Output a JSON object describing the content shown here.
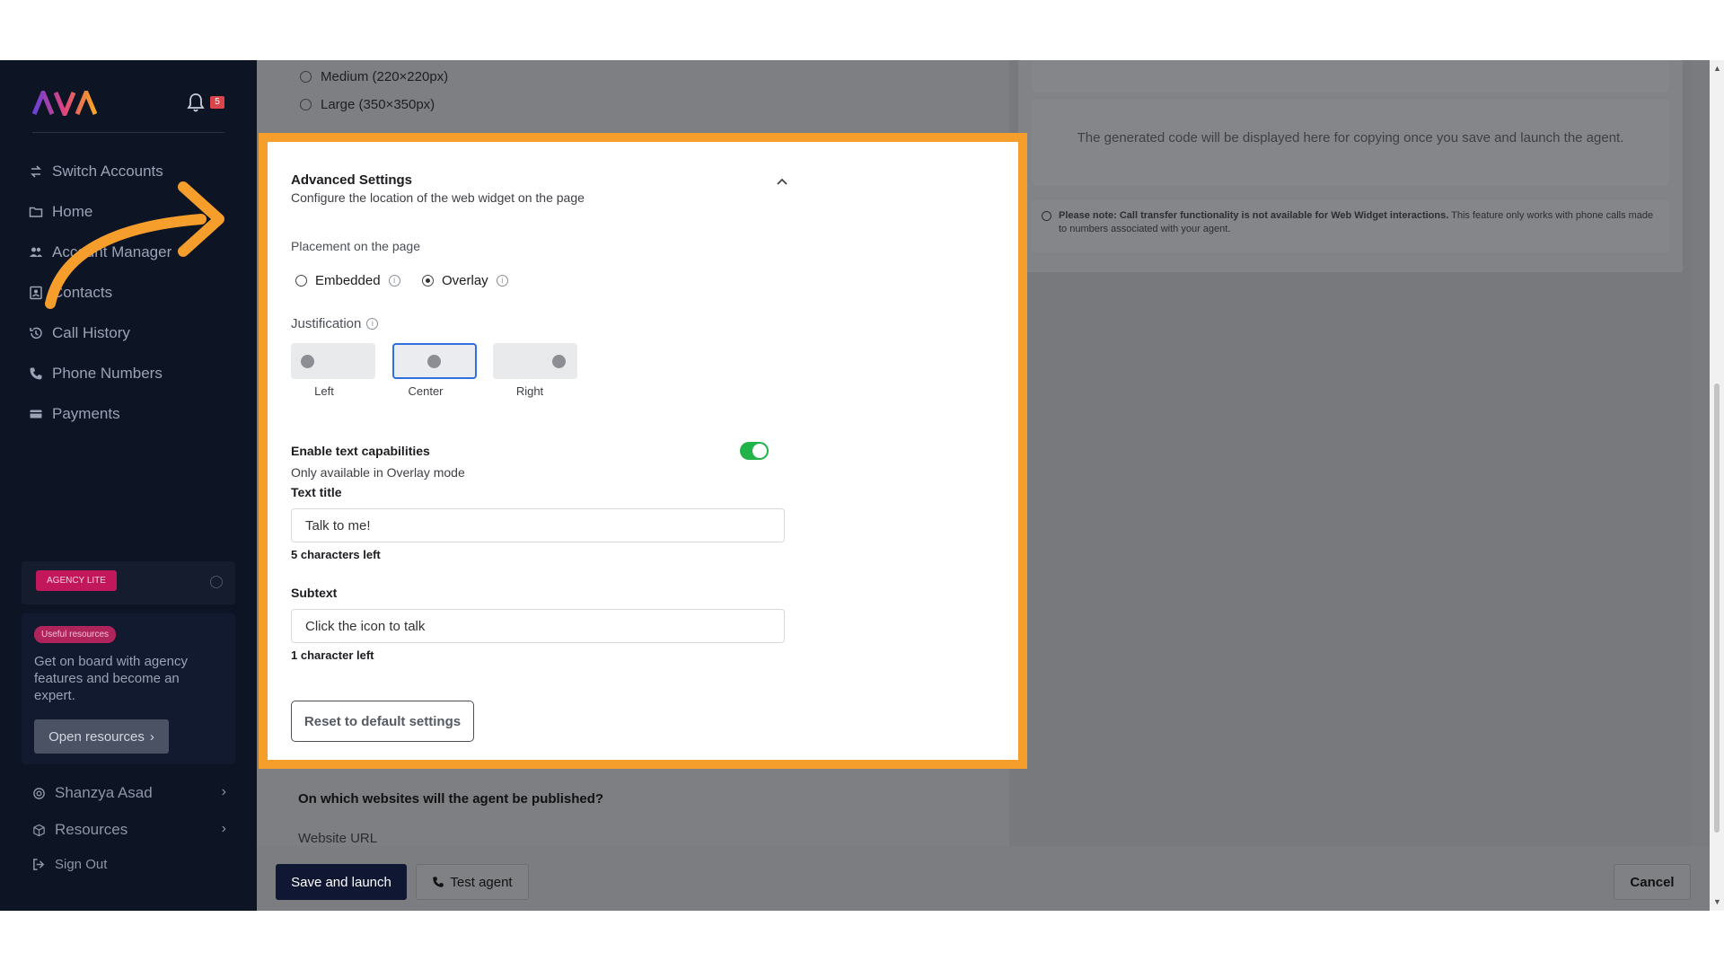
{
  "sidebar": {
    "brand": "AVA",
    "notification_count": "5",
    "nav": [
      {
        "label": "Switch Accounts",
        "icon": "switch-icon"
      },
      {
        "label": "Home",
        "icon": "folder-icon"
      },
      {
        "label": "Account Manager",
        "icon": "users-icon"
      },
      {
        "label": "Contacts",
        "icon": "contacts-icon"
      },
      {
        "label": "Call History",
        "icon": "history-icon"
      },
      {
        "label": "Phone Numbers",
        "icon": "phone-icon"
      },
      {
        "label": "Payments",
        "icon": "card-icon"
      }
    ],
    "plan_badge": "AGENCY LITE",
    "resources_card": {
      "badge": "Useful resources",
      "text": "Get on board with agency features and become an expert.",
      "button": "Open resources"
    },
    "user_name": "Shanzya Asad",
    "resources": "Resources",
    "sign_out": "Sign Out"
  },
  "background": {
    "size_options": [
      "Medium (220×220px)",
      "Large (350×350px)"
    ],
    "code_placeholder": "The generated code will be displayed here for copying once you save and launch the agent.",
    "note_bold": "Please note: Call transfer functionality is not available for Web Widget interactions.",
    "note_rest": " This feature only works with phone calls made to numbers associated with your agent.",
    "publish_question": "On which websites will the agent be published?",
    "website_url_label": "Website URL"
  },
  "advanced": {
    "title": "Advanced Settings",
    "subtitle": "Configure the location of the web widget on the page",
    "placement_label": "Placement on the page",
    "placement_options": [
      "Embedded",
      "Overlay"
    ],
    "placement_selected": "Overlay",
    "justification_label": "Justification",
    "justification_options": [
      "Left",
      "Center",
      "Right"
    ],
    "justification_selected": "Center",
    "text_capabilities_label": "Enable text capabilities",
    "text_capabilities_note": "Only available in Overlay mode",
    "text_capabilities_enabled": true,
    "text_title_label": "Text title",
    "text_title_value": "Talk to me!",
    "text_title_remaining": "5 characters left",
    "subtext_label": "Subtext",
    "subtext_value": "Click the icon to talk",
    "subtext_remaining": "1 character left",
    "reset_button": "Reset to default settings"
  },
  "footer": {
    "save_button": "Save and launch",
    "test_button": "Test agent",
    "cancel_button": "Cancel"
  },
  "colors": {
    "highlight": "#f59e2b",
    "sidebar_bg": "#0d1424",
    "toggle_on": "#22b34a",
    "selected_border": "#2f6fe0",
    "primary_button": "#0f1733"
  }
}
